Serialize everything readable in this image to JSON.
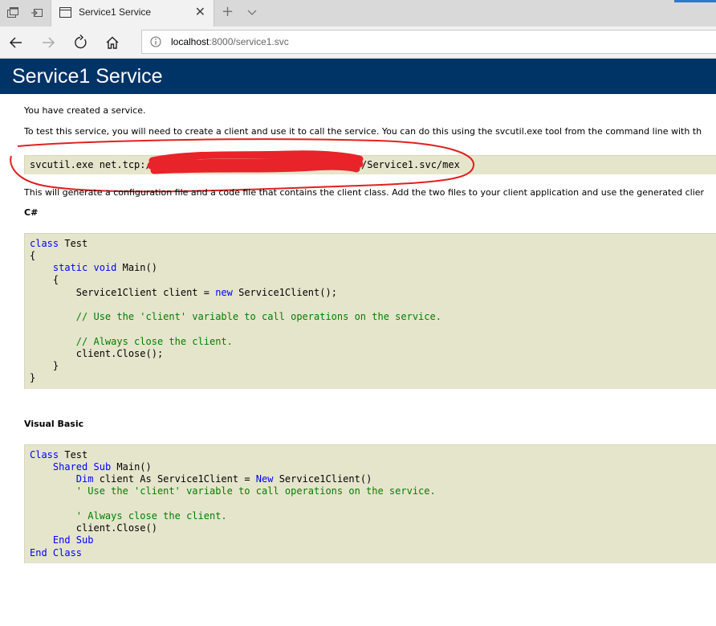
{
  "browser": {
    "tab_title": "Service1 Service",
    "tab_close_glyph": "✕",
    "newtab_glyph": "+",
    "url_host": "localhost",
    "url_rest": ":8000/service1.svc",
    "accent": "#2b79d0"
  },
  "page": {
    "heading": "Service1 Service",
    "heading_bg": "#003366",
    "intro": "You have created a service.",
    "instructions": "To test this service, you will need to create a client and use it to call the service. You can do this using the svcutil.exe tool from the command line with th",
    "svcutil_prefix": "svcutil.exe net.tcp:/",
    "svcutil_suffix": "/Service1.svc/mex",
    "generate_text": "This will generate a configuration file and a code file that contains the client class. Add the two files to your client application and use the generated clier",
    "csharp_heading": "C#",
    "vb_heading": "Visual Basic",
    "code_bg": "#e5e5cc"
  },
  "csharp": {
    "l1a": "class",
    "l1b": " Test",
    "l2": "{",
    "l3a": "    ",
    "l3b": "static",
    "l3c": " ",
    "l3d": "void",
    "l3e": " Main()",
    "l4": "    {",
    "l5a": "        Service1Client client = ",
    "l5b": "new",
    "l5c": " Service1Client();",
    "l6": "        // Use the 'client' variable to call operations on the service.",
    "l7": "        // Always close the client.",
    "l8": "        client.Close();",
    "l9": "    }",
    "l10": "}"
  },
  "vb": {
    "l1a": "Class",
    "l1b": " Test",
    "l2a": "    ",
    "l2b": "Shared",
    "l2c": " ",
    "l2d": "Sub",
    "l2e": " Main()",
    "l3a": "        ",
    "l3b": "Dim",
    "l3c": " client As Service1Client = ",
    "l3d": "New",
    "l3e": " Service1Client()",
    "l4": "        ' Use the 'client' variable to call operations on the service.",
    "l5": "        ' Always close the client.",
    "l6": "        client.Close()",
    "l7a": "    ",
    "l7b": "End Sub",
    "l8": "End Class"
  }
}
